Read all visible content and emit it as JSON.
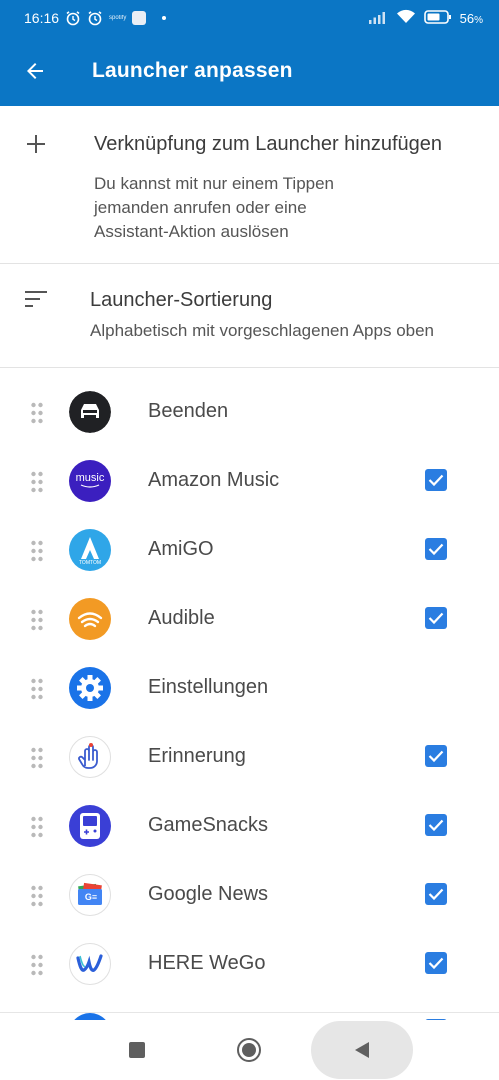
{
  "status_bar": {
    "time": "16:16",
    "battery": "56",
    "battery_unit": "%",
    "small_label": "spotify"
  },
  "app_bar": {
    "title": "Launcher anpassen"
  },
  "add_shortcut": {
    "title": "Verknüpfung zum Launcher hinzufügen",
    "description_lines": [
      "Du kannst mit nur einem Tippen",
      "jemanden anrufen oder eine",
      "Assistant-Aktion auslösen"
    ]
  },
  "sorting": {
    "title": "Launcher-Sortierung",
    "subtitle": "Alphabetisch mit vorgeschlagenen Apps oben"
  },
  "apps": [
    {
      "label": "Beenden",
      "checked": false,
      "icon": "exit-car-icon"
    },
    {
      "label": "Amazon Music",
      "checked": true,
      "icon": "amazon-music-icon",
      "icon_text": "music"
    },
    {
      "label": "AmiGO",
      "checked": true,
      "icon": "amigo-icon",
      "icon_text": "TOMTOM"
    },
    {
      "label": "Audible",
      "checked": true,
      "icon": "audible-icon"
    },
    {
      "label": "Einstellungen",
      "checked": false,
      "icon": "settings-gear-icon"
    },
    {
      "label": "Erinnerung",
      "checked": true,
      "icon": "reminder-hand-icon"
    },
    {
      "label": "GameSnacks",
      "checked": true,
      "icon": "gamesnacks-icon"
    },
    {
      "label": "Google News",
      "checked": true,
      "icon": "google-news-icon",
      "icon_text": "G≡"
    },
    {
      "label": "HERE WeGo",
      "checked": true,
      "icon": "here-wego-icon"
    }
  ],
  "colors": {
    "primary": "#0b76c5",
    "checkbox": "#2a7de1"
  }
}
